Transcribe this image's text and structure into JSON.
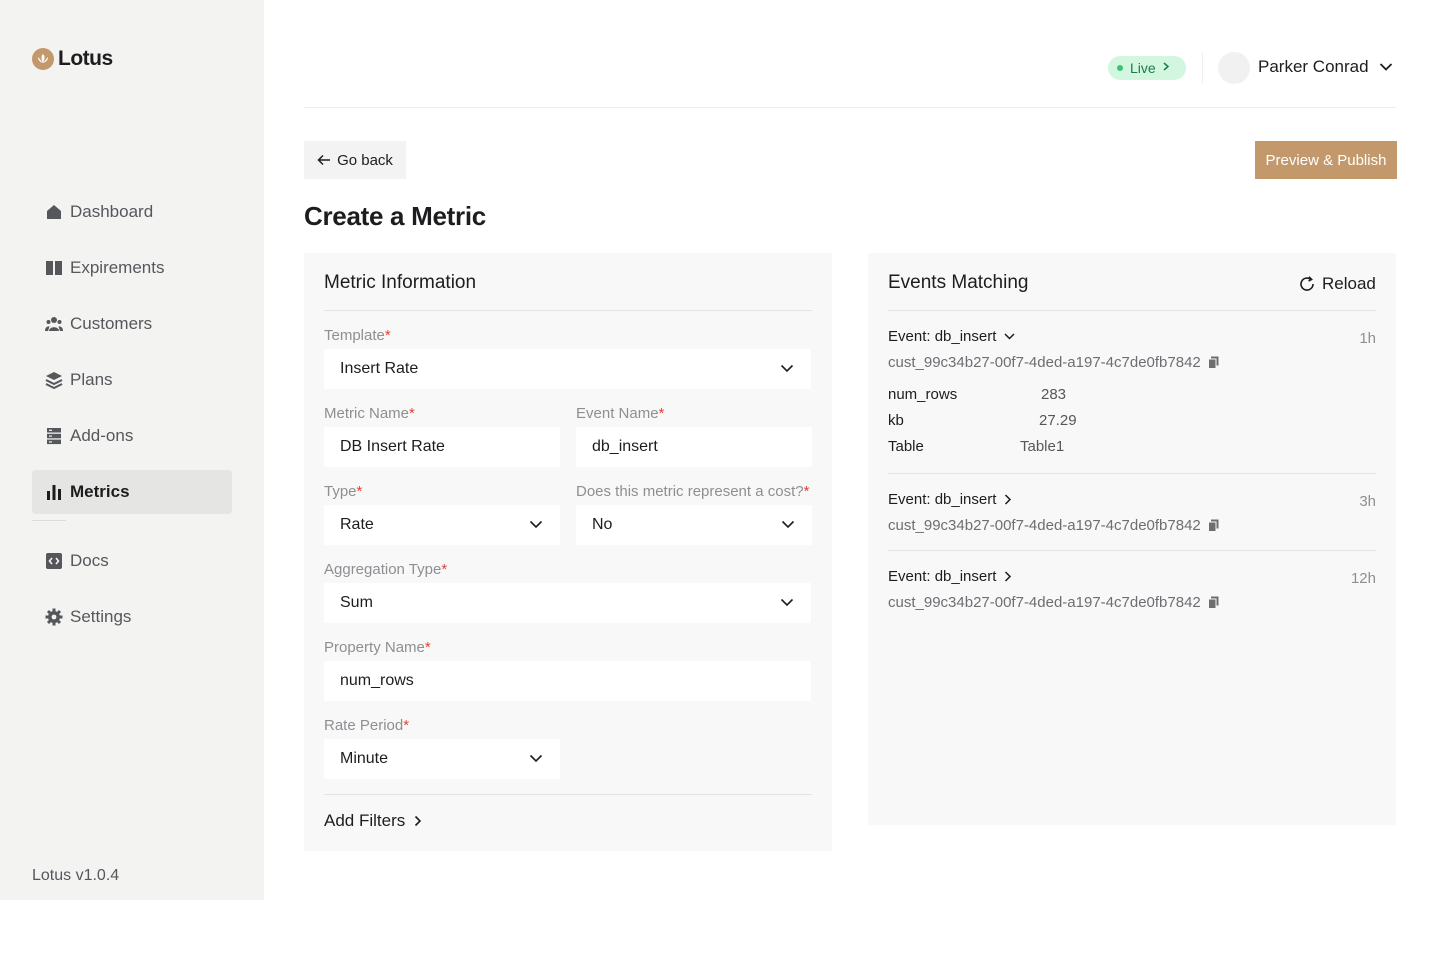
{
  "app": {
    "logo_text": "Lotus",
    "version": "Lotus v1.0.4"
  },
  "sidebar": {
    "items": [
      {
        "label": "Dashboard",
        "icon": "home-icon"
      },
      {
        "label": "Expirements",
        "icon": "book-icon"
      },
      {
        "label": "Customers",
        "icon": "users-icon"
      },
      {
        "label": "Plans",
        "icon": "layers-icon"
      },
      {
        "label": "Add-ons",
        "icon": "server-icon"
      },
      {
        "label": "Metrics",
        "icon": "bar-chart-icon",
        "active": true
      },
      {
        "label": "Docs",
        "icon": "code-icon"
      },
      {
        "label": "Settings",
        "icon": "gear-icon"
      }
    ]
  },
  "header": {
    "env_label": "Live",
    "user_name": "Parker Conrad"
  },
  "toolbar": {
    "back_label": "Go back",
    "publish_label": "Preview & Publish"
  },
  "page": {
    "title": "Create a Metric"
  },
  "form": {
    "title": "Metric Information",
    "template": {
      "label": "Template",
      "value": "Insert Rate"
    },
    "metric_name": {
      "label": "Metric Name",
      "value": "DB Insert Rate"
    },
    "event_name": {
      "label": "Event Name",
      "value": "db_insert"
    },
    "type": {
      "label": "Type",
      "value": "Rate"
    },
    "is_cost": {
      "label": "Does this metric represent a cost?",
      "value": "No"
    },
    "aggregation_type": {
      "label": "Aggregation Type",
      "value": "Sum"
    },
    "property_name": {
      "label": "Property Name",
      "value": "num_rows"
    },
    "rate_period": {
      "label": "Rate Period",
      "value": "Minute"
    },
    "add_filters_label": "Add Filters",
    "required_mark": "*"
  },
  "events_panel": {
    "title": "Events Matching",
    "reload_label": "Reload",
    "events": [
      {
        "name": "Event: db_insert",
        "customer": "cust_99c34b27-00f7-4ded-a197-4c7de0fb7842",
        "time": "1h",
        "expanded": true,
        "properties": [
          {
            "key": "num_rows",
            "value": "283"
          },
          {
            "key": "kb",
            "value": "27.29"
          },
          {
            "key": "Table",
            "value": "Table1"
          }
        ]
      },
      {
        "name": "Event: db_insert",
        "customer": "cust_99c34b27-00f7-4ded-a197-4c7de0fb7842",
        "time": "3h",
        "expanded": false
      },
      {
        "name": "Event: db_insert",
        "customer": "cust_99c34b27-00f7-4ded-a197-4c7de0fb7842",
        "time": "12h",
        "expanded": false
      }
    ]
  },
  "colors": {
    "brand": "#c3986b",
    "live_bg": "#d3f6e1",
    "live_text": "#1f7a47",
    "required": "#e0433a"
  }
}
